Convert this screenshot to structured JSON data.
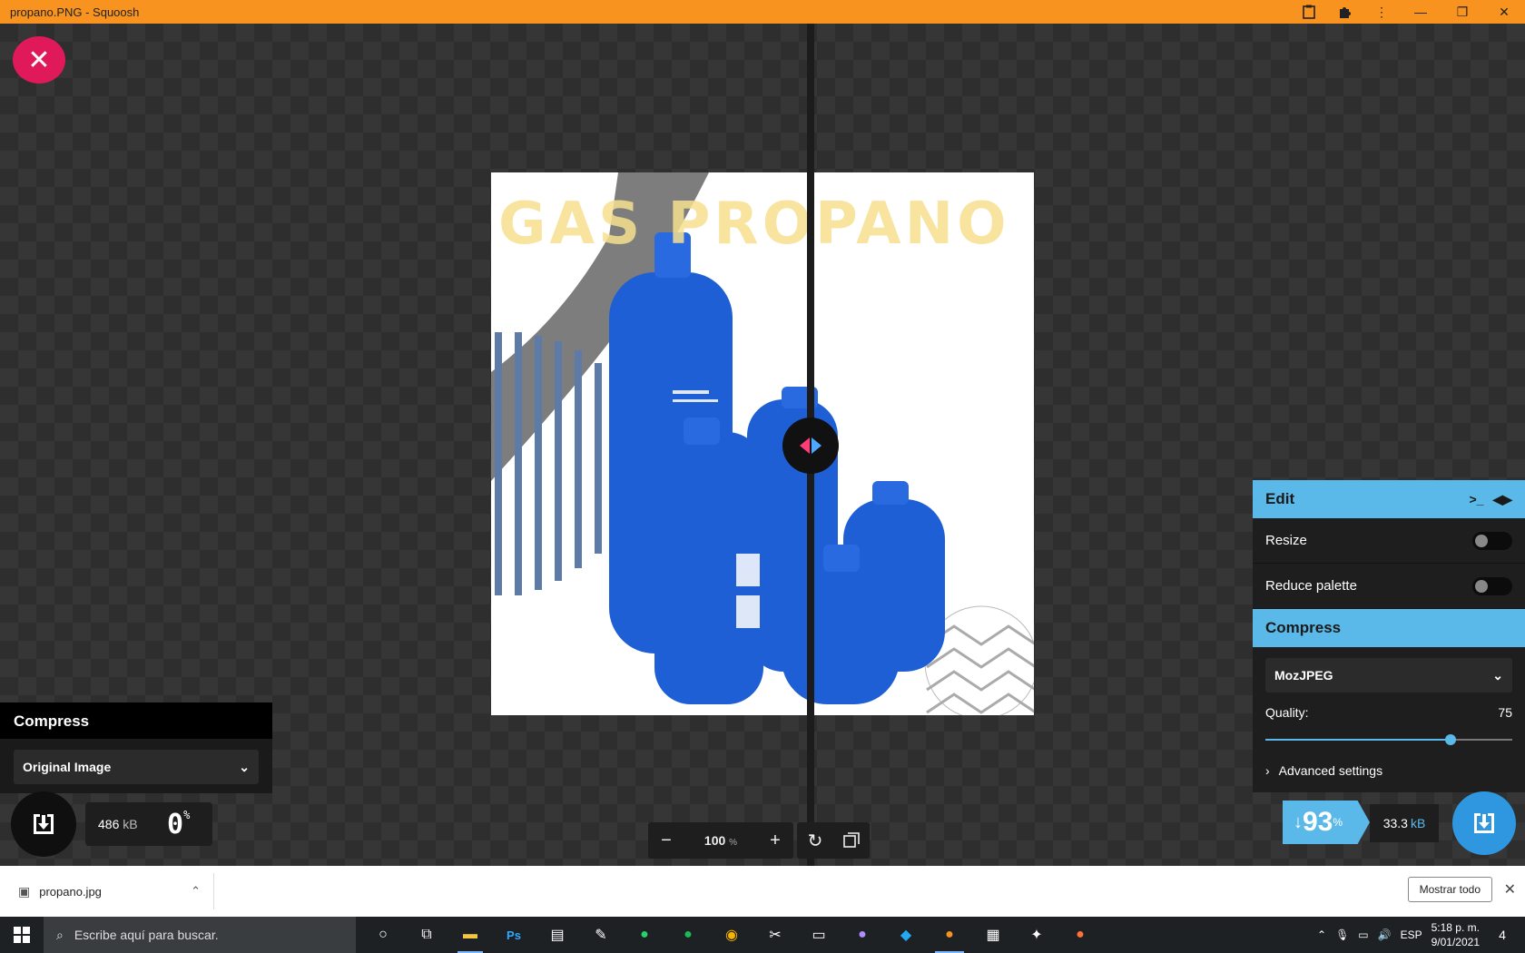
{
  "window": {
    "title": "propano.PNG - Squoosh",
    "icons": [
      "clipboard-icon",
      "extension-icon",
      "more-icon"
    ],
    "controls": {
      "minimize": "—",
      "maximize": "❐",
      "close": "✕"
    }
  },
  "image": {
    "heading": "GAS PROPANO"
  },
  "left_panel": {
    "header": "Compress",
    "select_value": "Original Image",
    "size": "486",
    "size_unit": "kB",
    "percent": "0",
    "percent_unit": "%"
  },
  "zoom": {
    "value": "100",
    "unit": "%",
    "minus": "−",
    "plus": "+"
  },
  "right_panel": {
    "edit_header": "Edit",
    "resize_label": "Resize",
    "resize_on": false,
    "reduce_palette_label": "Reduce palette",
    "reduce_palette_on": false,
    "compress_header": "Compress",
    "codec": "MozJPEG",
    "quality_label": "Quality:",
    "quality_value": "75",
    "quality_fraction": 0.75,
    "advanced_label": "Advanced settings",
    "result_percent": "93",
    "result_percent_prefix": "↓",
    "result_percent_unit": "%",
    "result_size": "33.3",
    "result_size_unit": "kB"
  },
  "download_bar": {
    "file_name": "propano.jpg",
    "show_all": "Mostrar todo"
  },
  "taskbar": {
    "search_placeholder": "Escribe aquí para buscar.",
    "language": "ESP",
    "time": "5:18 p. m.",
    "date": "9/01/2021",
    "notifications": "4"
  },
  "colors": {
    "titlebar": "#f7931e",
    "accent": "#5bb9ea",
    "close_button": "#e0195b",
    "download_button": "#2f97e0"
  }
}
